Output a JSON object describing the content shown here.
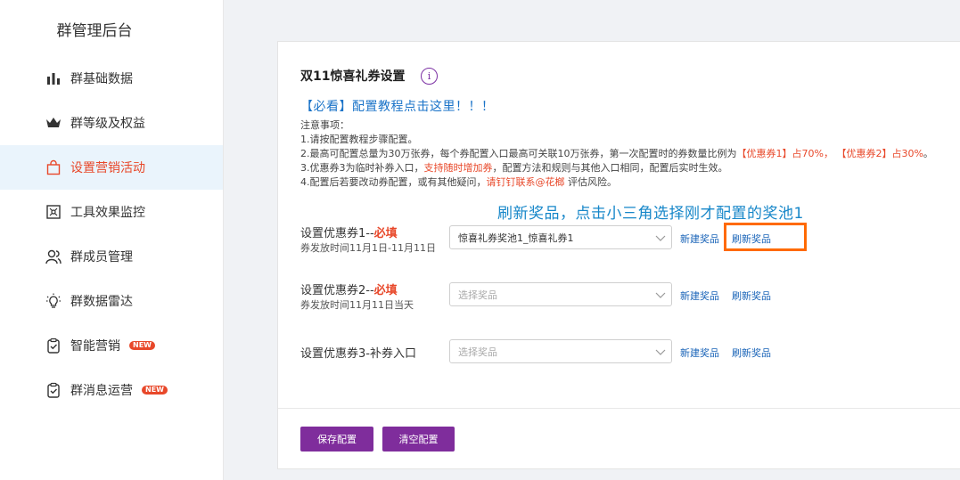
{
  "app": {
    "title": "群管理后台"
  },
  "sidebar": {
    "items": [
      {
        "label": "群基础数据",
        "icon": "bar-chart-icon"
      },
      {
        "label": "群等级及权益",
        "icon": "crown-icon"
      },
      {
        "label": "设置营销活动",
        "icon": "shopping-bag-icon",
        "active": true
      },
      {
        "label": "工具效果监控",
        "icon": "monitor-icon"
      },
      {
        "label": "群成员管理",
        "icon": "users-icon"
      },
      {
        "label": "群数据雷达",
        "icon": "lightbulb-icon"
      },
      {
        "label": "智能营销",
        "icon": "clipboard-check-icon",
        "badge": "NEW"
      },
      {
        "label": "群消息运营",
        "icon": "clipboard-check-icon",
        "badge": "NEW"
      }
    ]
  },
  "main": {
    "title": "双11惊喜礼券设置",
    "info_icon": "i",
    "tutorial_link": "【必看】配置教程点击这里！！！",
    "notes": {
      "heading": "注意事项：",
      "line1": "1.请按配置教程步骤配置。",
      "line2_a": "2.最高可配置总量为30万张券，每个券配置入口最高可关联10万张券，第一次配置时的券数量比例为",
      "line2_b": "【优惠券1】占70%，",
      "line2_c": "【优惠券2】占30%",
      "line2_d": "。",
      "line3_a": "3.优惠券3为临时补券入口，",
      "line3_b": "支持随时增加券",
      "line3_c": "，配置方法和规则与其他入口相同，配置后实时生效。",
      "line4_a": "4.配置后若要改动券配置，或有其他疑问，",
      "line4_b": "请钉钉联系@花榔",
      "line4_c": " 评估风险。"
    },
    "annotation": "刷新奖品，点击小三角选择刚才配置的奖池1",
    "coupons": [
      {
        "label": "设置优惠券1--",
        "required": "必填",
        "sub": "券发放时间11月1日-11月11日",
        "selected": "惊喜礼券奖池1_惊喜礼券1",
        "new_link": "新建奖品",
        "refresh_link": "刷新奖品"
      },
      {
        "label": "设置优惠券2--",
        "required": "必填",
        "sub": "券发放时间11月11日当天",
        "placeholder": "选择奖品",
        "new_link": "新建奖品",
        "refresh_link": "刷新奖品"
      },
      {
        "label": "设置优惠券3-补券入口",
        "required": "",
        "sub": "",
        "placeholder": "选择奖品",
        "new_link": "新建奖品",
        "refresh_link": "刷新奖品"
      }
    ],
    "buttons": {
      "save": "保存配置",
      "clear": "清空配置"
    }
  },
  "colors": {
    "accent": "#7f2d9c",
    "link": "#1a64b8",
    "alert": "#e8482a",
    "highlight": "#ff6a00",
    "annotation": "#1787c9",
    "active_bg": "#eaf4fc"
  }
}
